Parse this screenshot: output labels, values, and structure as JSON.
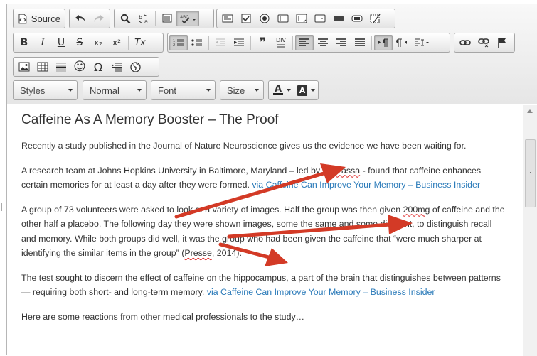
{
  "toolbar": {
    "source_label": "Source",
    "styles_label": "Styles",
    "format_label": "Normal",
    "font_label": "Font",
    "size_label": "Size",
    "blockquote_glyph": "❞",
    "div_glyph": "DIV",
    "smiley_glyph": "☺",
    "omega_glyph": "Ω",
    "italic_glyph": "I",
    "underline_glyph": "U",
    "bold_glyph": "B",
    "strike_glyph": "S",
    "subscript_glyph": "x₂",
    "superscript_glyph": "x²",
    "removeformat_glyph": "Tx",
    "textcolor_glyph": "A",
    "bgcolor_glyph": "A",
    "spell_glyph": "ABC",
    "accent_color": "#d33a26"
  },
  "content": {
    "heading": "Caffeine As A Memory Booster – The Proof",
    "p1": "Recently a study published in the Journal of Nature Neuroscience gives us the evidence we have been waiting for.",
    "p2_a": "A research team at Johns Hopkins University in Baltimore, Maryland – led by Dr. ",
    "p2_yassa": "Yassa",
    "p2_b": " - found that caffeine enhances certain memories for at least a day after they were formed. ",
    "p2_link": "via Caffeine Can Improve Your Memory – Business Insider",
    "p3_a": "A group of 73 volunteers were asked to look at a variety of images. Half the group was then given ",
    "p3_mg": "200mg",
    "p3_b": " of caffeine and the other half a placebo. The following day they were shown images, some the same and some different, to distinguish recall and memory. While both groups did well, it was the group who had been given the caffeine that “were much sharper at identifying the similar items in the group” (",
    "p3_presse": "Presse",
    "p3_c": ", 2014).",
    "p4_a": "The test sought to discern the effect of caffeine on the hippocampus, a part of the brain that distinguishes between patterns — requiring both short- and long-term memory. ",
    "p4_link": "via Caffeine Can Improve Your Memory – Business Insider",
    "p5": "Here are some reactions from other medical professionals to the study…"
  }
}
